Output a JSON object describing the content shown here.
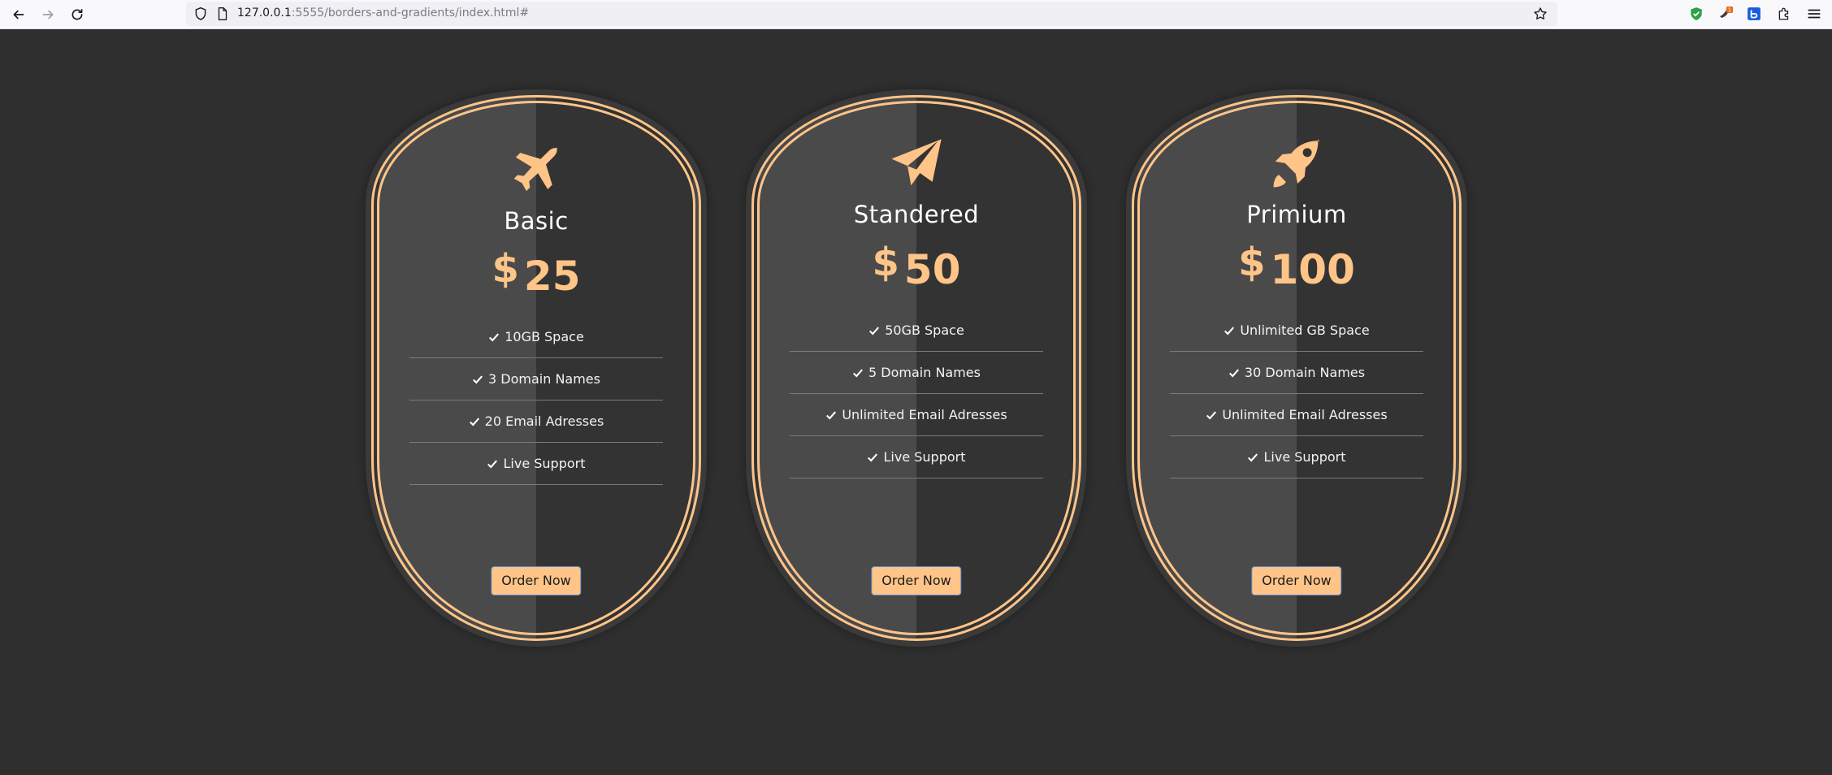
{
  "browser": {
    "url_host": "127.0.0.1",
    "url_rest": ":5555/borders-and-gradients/index.html#",
    "ext_badge": "1"
  },
  "colors": {
    "background": "#2f2f2f",
    "accent": "#ffc488",
    "card_light": "#4a4a4a",
    "card_dark": "#333333"
  },
  "plans": [
    {
      "icon": "plane-icon",
      "name": "Basic",
      "currency": "$",
      "amount": "25",
      "features": [
        "10GB Space",
        "3 Domain Names",
        "20 Email Adresses",
        "Live Support"
      ],
      "button": "Order Now"
    },
    {
      "icon": "paper-plane-icon",
      "name": "Standered",
      "currency": "$",
      "amount": "50",
      "features": [
        "50GB Space",
        "5 Domain Names",
        "Unlimited Email Adresses",
        "Live Support"
      ],
      "button": "Order Now"
    },
    {
      "icon": "rocket-icon",
      "name": "Primium",
      "currency": "$",
      "amount": "100",
      "features": [
        "Unlimited GB Space",
        "30 Domain Names",
        "Unlimited Email Adresses",
        "Live Support"
      ],
      "button": "Order Now"
    }
  ]
}
